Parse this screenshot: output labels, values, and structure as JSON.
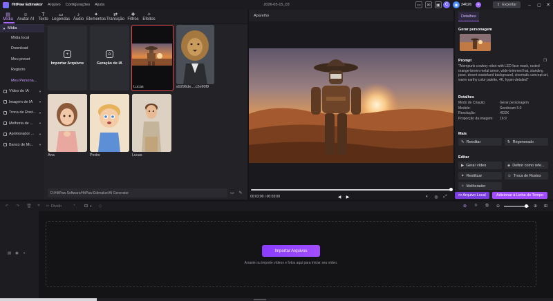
{
  "titlebar": {
    "app_name": "HitPaw Edimakor",
    "menus": [
      "Arquivo",
      "Configurações",
      "Ajuda"
    ],
    "project_title": "2026-05-15_03",
    "credits": "24026",
    "export_label": "Exportar"
  },
  "toolbar": {
    "items": [
      {
        "label": "Mídia",
        "icon": "media-icon"
      },
      {
        "label": "Avatar AI",
        "icon": "avatar-icon"
      },
      {
        "label": "Texto",
        "icon": "text-icon"
      },
      {
        "label": "Legendas",
        "icon": "subtitle-icon"
      },
      {
        "label": "Áudio",
        "icon": "audio-icon"
      },
      {
        "label": "Elementos",
        "icon": "elements-icon"
      },
      {
        "label": "Transição",
        "icon": "transition-icon"
      },
      {
        "label": "Filtros",
        "icon": "filter-icon"
      },
      {
        "label": "Efeitos",
        "icon": "effects-icon"
      }
    ]
  },
  "sidebar": {
    "head": "Mídia",
    "subitems": [
      "Mídia local",
      "Download",
      "Meu preset",
      "Registro",
      "Meu Persona..."
    ],
    "sections": [
      "Vídeo de IA",
      "Imagem de IA",
      "Troca de Rost...",
      "Melhoria de ...",
      "Aprimorador ...",
      "Banco de Mi..."
    ]
  },
  "media": {
    "import_label": "Importar Arquivos",
    "ai_gen_label": "Geração de IA",
    "items": [
      {
        "label": "Lucas"
      },
      {
        "label": "a9296de....c2e90f9"
      },
      {
        "label": "Ana"
      },
      {
        "label": "Pedro"
      },
      {
        "label": "Lucas"
      }
    ],
    "path": "D:/HitPaw Software/HitPaw Edimakor/AI Generator"
  },
  "player": {
    "title": "Aparelho",
    "time": "00:03:00 / 00:03:00"
  },
  "details": {
    "tab": "Detalhes",
    "gen_section": "Gerar personagem",
    "prompt_title": "Prompt",
    "prompt_text": "\"Atompunk cowboy robot with LED face mask, rusted orange-brown metal armor, wide-brimmed hat, standing pose, desert wasteland background, cinematic concept art, warm earthy color palette, 4K, hyper-detailed\"",
    "details_title": "Detalhes",
    "kv": [
      {
        "k": "Modo de Criação:",
        "v": "Gerar personagem"
      },
      {
        "k": "Modelo:",
        "v": "Seedream 5.0"
      },
      {
        "k": "Resolução:",
        "v": "HD2K"
      },
      {
        "k": "Proporção da imagem:",
        "v": "16:9"
      }
    ],
    "more_title": "Mais",
    "redo": "Reeditar",
    "regen": "Regenerado",
    "edit_title": "Editar",
    "gen_video": "Gerar vídeo",
    "set_ref": "Definir como refe...",
    "resize": "Restilizar",
    "face_swap": "Troca de Rostos",
    "enhancer": "Melhorador",
    "open_local": "rir Arquivo Local",
    "add_timeline": "Adicionar à Linha do Tempo"
  },
  "timeline": {
    "divide": "Dividir",
    "import_label": "Importar Arquivos",
    "hint": "Arraste ou importe vídeos e fotos aqui para iniciar seu vídeo."
  },
  "colors": {
    "accent": "#a24dff",
    "bg": "#16161a"
  }
}
